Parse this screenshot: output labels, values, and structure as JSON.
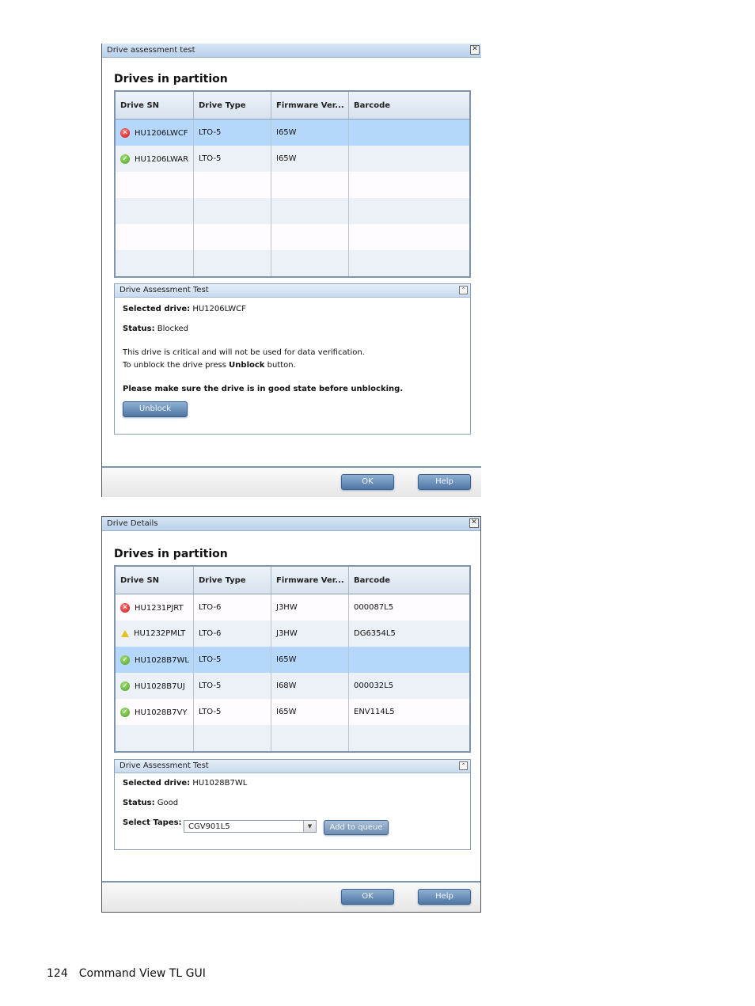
{
  "dialog1": {
    "title": "Drive assessment test",
    "section_title": "Drives in partition",
    "columns": [
      "Drive SN",
      "Drive Type",
      "Firmware Ver...",
      "Barcode"
    ],
    "rows": [
      {
        "status": "error",
        "sn": "HU1206LWCF",
        "type": "LTO-5",
        "firmware": "I65W",
        "barcode": "",
        "selected": true
      },
      {
        "status": "ok",
        "sn": "HU1206LWAR",
        "type": "LTO-5",
        "firmware": "I65W",
        "barcode": "",
        "selected": false
      }
    ],
    "panel": {
      "title": "Drive Assessment Test",
      "selected_label": "Selected drive:",
      "selected_value": "HU1206LWCF",
      "status_label": "Status:",
      "status_value": "Blocked",
      "msg1": "This drive is critical and will not be used for data verification.",
      "msg2_pre": "To unblock the drive press ",
      "msg2_bold": "Unblock",
      "msg2_post": " button.",
      "warning": "Please make sure the drive is in good state before unblocking.",
      "unblock_label": "Unblock"
    },
    "ok_label": "OK",
    "help_label": "Help"
  },
  "dialog2": {
    "title": "Drive Details",
    "section_title": "Drives in partition",
    "columns": [
      "Drive SN",
      "Drive Type",
      "Firmware Ver...",
      "Barcode"
    ],
    "rows": [
      {
        "status": "error",
        "sn": "HU1231PJRT",
        "type": "LTO-6",
        "firmware": "J3HW",
        "barcode": "000087L5",
        "selected": false
      },
      {
        "status": "warning",
        "sn": "HU1232PMLT",
        "type": "LTO-6",
        "firmware": "J3HW",
        "barcode": "DG6354L5",
        "selected": false
      },
      {
        "status": "ok",
        "sn": "HU1028B7WL",
        "type": "LTO-5",
        "firmware": "I65W",
        "barcode": "",
        "selected": true
      },
      {
        "status": "ok",
        "sn": "HU1028B7UJ",
        "type": "LTO-5",
        "firmware": "I68W",
        "barcode": "000032L5",
        "selected": false
      },
      {
        "status": "ok",
        "sn": "HU1028B7VY",
        "type": "LTO-5",
        "firmware": "I65W",
        "barcode": "ENV114L5",
        "selected": false
      }
    ],
    "panel": {
      "title": "Drive Assessment Test",
      "selected_label": "Selected drive:",
      "selected_value": "HU1028B7WL",
      "status_label": "Status:",
      "status_value": "Good",
      "tapes_label": "Select Tapes:",
      "tapes_value": "CGV901L5",
      "add_label": "Add to queue"
    },
    "ok_label": "OK",
    "help_label": "Help"
  },
  "page_footer": {
    "page_number": "124",
    "title": "Command View TL GUI"
  }
}
